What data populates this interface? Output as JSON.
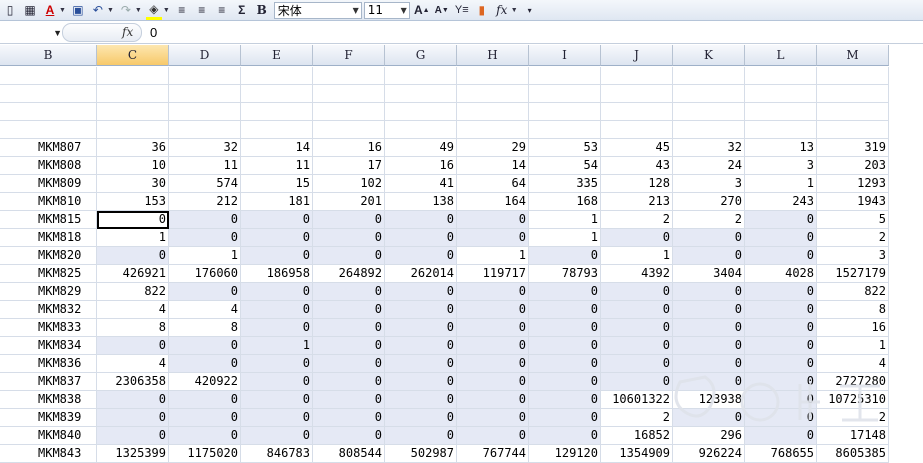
{
  "toolbar": {
    "font_name": "宋体",
    "font_size": "11"
  },
  "formula_bar": {
    "value": "0"
  },
  "columns": [
    "B",
    "C",
    "D",
    "E",
    "F",
    "G",
    "H",
    "I",
    "J",
    "K",
    "L",
    "M"
  ],
  "rows": [
    {
      "label": "MKM807",
      "values": [
        "36",
        "32",
        "14",
        "16",
        "49",
        "29",
        "53",
        "45",
        "32",
        "13",
        "319"
      ]
    },
    {
      "label": "MKM808",
      "values": [
        "10",
        "11",
        "11",
        "17",
        "16",
        "14",
        "54",
        "43",
        "24",
        "3",
        "203"
      ]
    },
    {
      "label": "MKM809",
      "values": [
        "30",
        "574",
        "15",
        "102",
        "41",
        "64",
        "335",
        "128",
        "3",
        "1",
        "1293"
      ]
    },
    {
      "label": "MKM810",
      "values": [
        "153",
        "212",
        "181",
        "201",
        "138",
        "164",
        "168",
        "213",
        "270",
        "243",
        "1943"
      ]
    },
    {
      "label": "MKM815",
      "values": [
        "0",
        "0",
        "0",
        "0",
        "0",
        "0",
        "1",
        "2",
        "2",
        "0",
        "5"
      ]
    },
    {
      "label": "MKM818",
      "values": [
        "1",
        "0",
        "0",
        "0",
        "0",
        "0",
        "1",
        "0",
        "0",
        "0",
        "2"
      ]
    },
    {
      "label": "MKM820",
      "values": [
        "0",
        "1",
        "0",
        "0",
        "0",
        "1",
        "0",
        "1",
        "0",
        "0",
        "3"
      ]
    },
    {
      "label": "MKM825",
      "values": [
        "426921",
        "176060",
        "186958",
        "264892",
        "262014",
        "119717",
        "78793",
        "4392",
        "3404",
        "4028",
        "1527179"
      ]
    },
    {
      "label": "MKM829",
      "values": [
        "822",
        "0",
        "0",
        "0",
        "0",
        "0",
        "0",
        "0",
        "0",
        "0",
        "822"
      ]
    },
    {
      "label": "MKM832",
      "values": [
        "4",
        "4",
        "0",
        "0",
        "0",
        "0",
        "0",
        "0",
        "0",
        "0",
        "8"
      ]
    },
    {
      "label": "MKM833",
      "values": [
        "8",
        "8",
        "0",
        "0",
        "0",
        "0",
        "0",
        "0",
        "0",
        "0",
        "16"
      ]
    },
    {
      "label": "MKM834",
      "values": [
        "0",
        "0",
        "1",
        "0",
        "0",
        "0",
        "0",
        "0",
        "0",
        "0",
        "1"
      ]
    },
    {
      "label": "MKM836",
      "values": [
        "4",
        "0",
        "0",
        "0",
        "0",
        "0",
        "0",
        "0",
        "0",
        "0",
        "4"
      ]
    },
    {
      "label": "MKM837",
      "values": [
        "2306358",
        "420922",
        "0",
        "0",
        "0",
        "0",
        "0",
        "0",
        "0",
        "0",
        "2727280"
      ]
    },
    {
      "label": "MKM838",
      "values": [
        "0",
        "0",
        "0",
        "0",
        "0",
        "0",
        "0",
        "10601322",
        "123938",
        "0",
        "10725310"
      ]
    },
    {
      "label": "MKM839",
      "values": [
        "0",
        "0",
        "0",
        "0",
        "0",
        "0",
        "0",
        "2",
        "0",
        "0",
        "2"
      ]
    },
    {
      "label": "MKM840",
      "values": [
        "0",
        "0",
        "0",
        "0",
        "0",
        "0",
        "0",
        "16852",
        "296",
        "0",
        "17148"
      ]
    },
    {
      "label": "MKM843",
      "values": [
        "1325399",
        "1175020",
        "846783",
        "808544",
        "502987",
        "767744",
        "129120",
        "1354909",
        "926224",
        "768655",
        "8605385"
      ]
    }
  ],
  "colors": {
    "highlight": "#e5e9f5",
    "selected_header": "#f7c96a"
  }
}
